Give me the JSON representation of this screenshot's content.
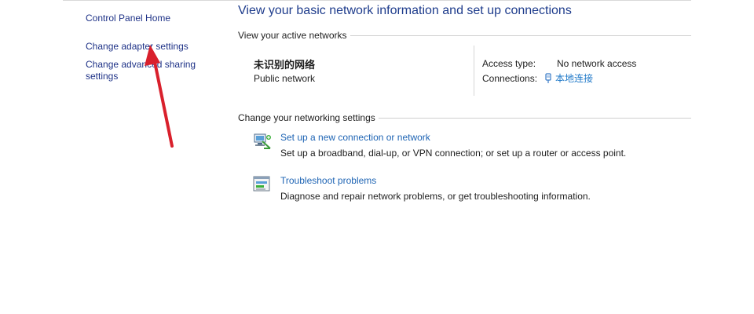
{
  "left_pane": {
    "items": [
      {
        "label": "Control Panel Home"
      },
      {
        "label": "Change adapter settings"
      },
      {
        "label": "Change advanced sharing settings"
      }
    ]
  },
  "main": {
    "title": "View your basic network information and set up connections",
    "active_networks": {
      "header": "View your active networks",
      "network_name": "未识别的网络",
      "network_type": "Public network",
      "access_type_label": "Access type:",
      "access_type_value": "No network access",
      "connections_label": "Connections:",
      "connection_name": "本地连接"
    },
    "settings": {
      "header": "Change your networking settings",
      "tasks": [
        {
          "link": "Set up a new connection or network",
          "description": "Set up a broadband, dial-up, or VPN connection; or set up a router or access point.",
          "icon": "new-connection-icon"
        },
        {
          "link": "Troubleshoot problems",
          "description": "Diagnose and repair network problems, or get troubleshooting information.",
          "icon": "troubleshoot-icon"
        }
      ]
    }
  },
  "annotation": {
    "icon": "red-arrow-icon",
    "color": "#d9202c"
  },
  "colors": {
    "link": "#1e64b4",
    "nav_link": "#1e3287",
    "title": "#1e3c8c"
  }
}
